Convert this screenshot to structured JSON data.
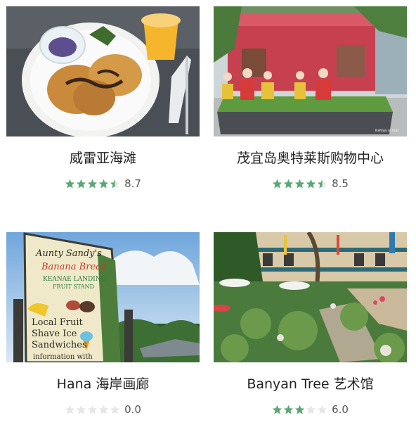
{
  "colors": {
    "star_on": "#5aa874",
    "star_off": "#e6e6e6"
  },
  "cards": [
    {
      "title": "威雷亚海滩",
      "score": "8.7",
      "rating": 4.5,
      "image": "waffle-breakfast-photo"
    },
    {
      "title": "茂宜岛奥特莱斯购物中心",
      "score": "8.5",
      "rating": 4.5,
      "image": "hula-dancers-mall-photo"
    },
    {
      "title": "Hana 海岸画廊",
      "score": "0.0",
      "rating": 0,
      "image": "banana-bread-sign-photo",
      "sign_lines": [
        "Aunty Sandy's",
        "Banana Bread",
        "KEANAE LANDING",
        "FRUIT STAND",
        "Local Fruit",
        "Shave Ice",
        "Sandwiches",
        "information with"
      ]
    },
    {
      "title": "Banyan Tree 艺术馆",
      "score": "6.0",
      "rating": 3,
      "image": "courtyard-garden-photo"
    }
  ]
}
